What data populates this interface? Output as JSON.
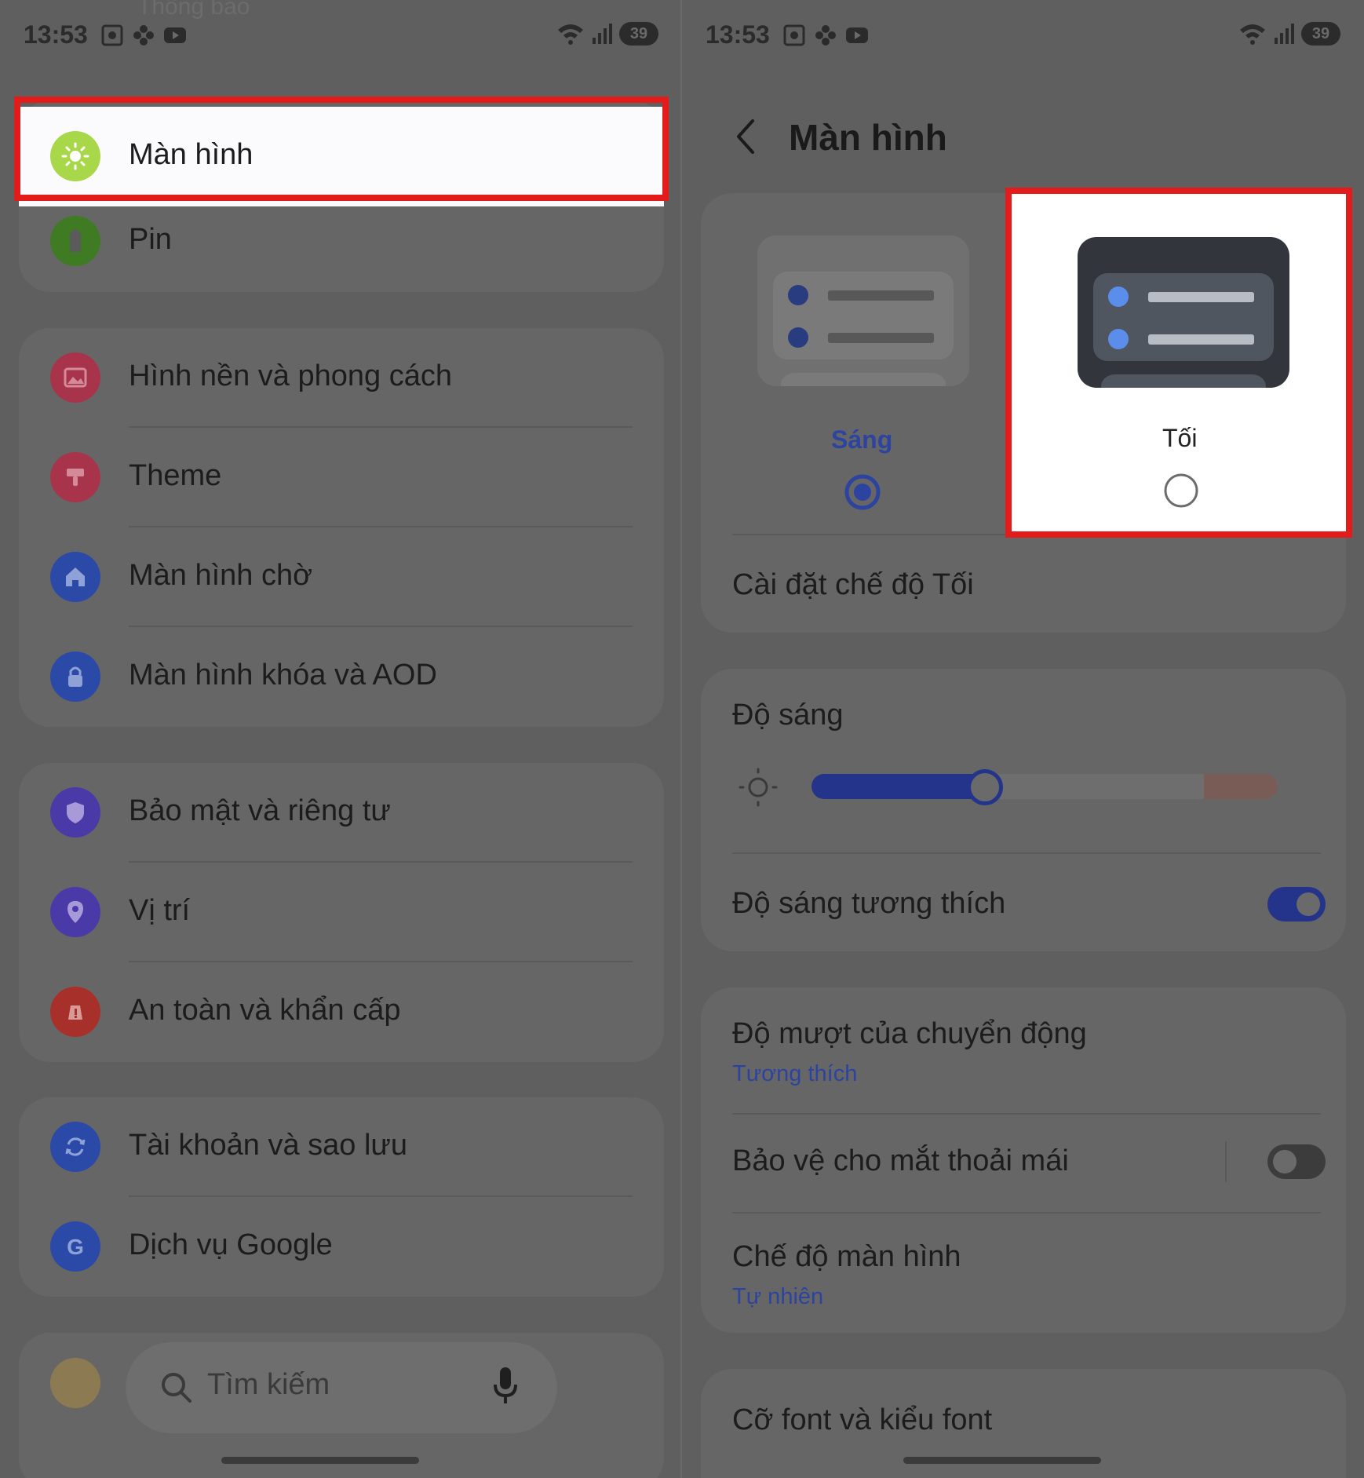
{
  "status_bar": {
    "time": "13:53",
    "battery": "39"
  },
  "left": {
    "ghost_text": "Thông báo",
    "highlighted_item": {
      "label": "Màn hình",
      "icon": "sun-icon",
      "icon_color": "#9ed23a"
    },
    "group1": [
      {
        "label": "Pin",
        "icon": "battery-icon",
        "icon_color": "#3e7b22"
      }
    ],
    "group2": [
      {
        "label": "Hình nền và phong cách",
        "icon": "wallpaper-icon",
        "icon_color": "#a8344c"
      },
      {
        "label": "Theme",
        "icon": "theme-brush-icon",
        "icon_color": "#a8344c"
      },
      {
        "label": "Màn hình chờ",
        "icon": "home-icon",
        "icon_color": "#2b4aa8"
      },
      {
        "label": "Màn hình khóa và AOD",
        "icon": "lock-icon",
        "icon_color": "#2b4aa8"
      }
    ],
    "group3": [
      {
        "label": "Bảo mật và riêng tư",
        "icon": "shield-icon",
        "icon_color": "#4a3aa8"
      },
      {
        "label": "Vị trí",
        "icon": "location-pin-icon",
        "icon_color": "#4a3aa8"
      },
      {
        "label": "An toàn và khẩn cấp",
        "icon": "emergency-icon",
        "icon_color": "#a8302a"
      }
    ],
    "group4": [
      {
        "label": "Tài khoản và sao lưu",
        "icon": "sync-icon",
        "icon_color": "#2b4aa8"
      },
      {
        "label": "Dịch vụ Google",
        "icon": "google-icon",
        "icon_color": "#2b4aa8"
      }
    ],
    "search": {
      "placeholder": "Tìm kiếm"
    }
  },
  "right": {
    "title": "Màn hình",
    "theme_options": {
      "light": {
        "label": "Sáng",
        "selected": true
      },
      "dark": {
        "label": "Tối",
        "selected": false
      }
    },
    "dark_mode_settings": "Cài đặt chế độ Tối",
    "brightness": {
      "label": "Độ sáng",
      "level": 0.34
    },
    "adaptive_brightness": {
      "label": "Độ sáng tương thích",
      "on": true
    },
    "motion_smoothness": {
      "label": "Độ mượt của chuyển động",
      "value": "Tương thích"
    },
    "eye_comfort": {
      "label": "Bảo vệ cho mắt thoải mái",
      "on": false
    },
    "screen_mode": {
      "label": "Chế độ màn hình",
      "value": "Tự nhiên"
    },
    "font": {
      "label": "Cỡ font và kiểu font"
    }
  },
  "colors": {
    "accent": "#2c44a0",
    "highlight": "#e41b1b",
    "dim_bg": "#5f5f5f"
  }
}
